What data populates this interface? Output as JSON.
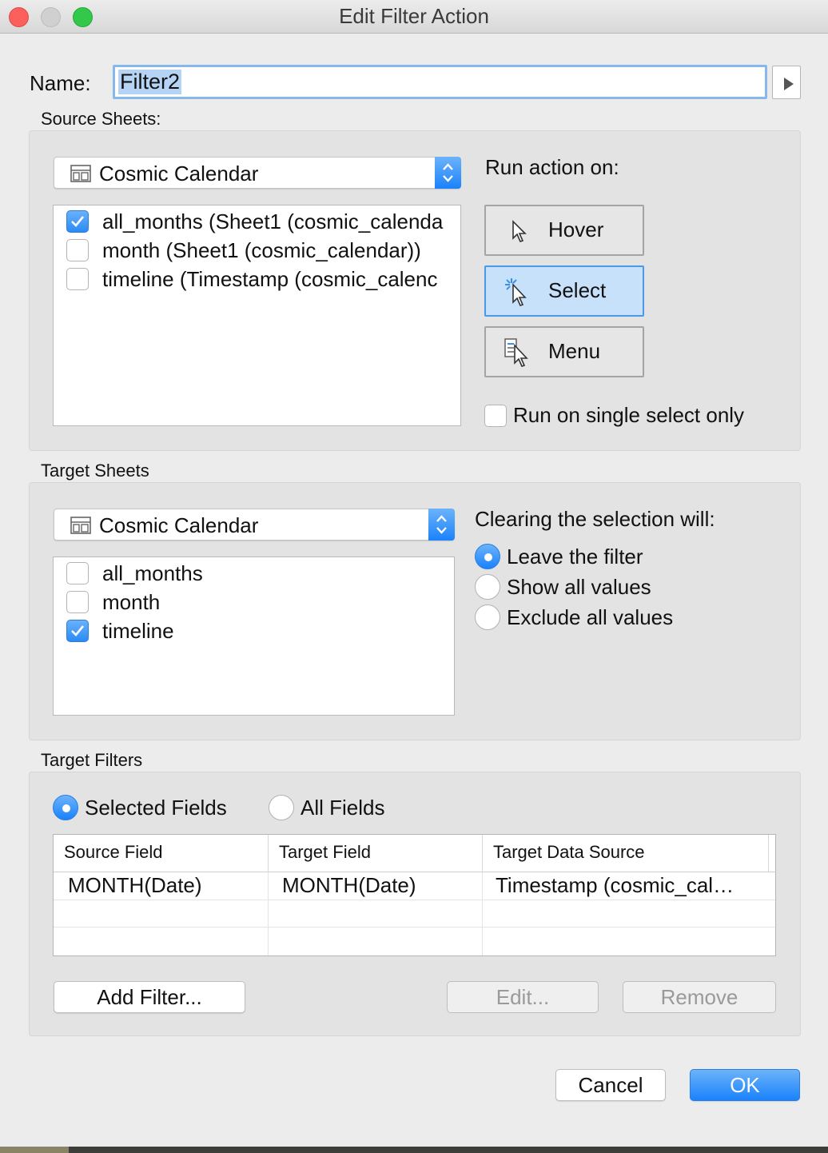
{
  "window": {
    "title": "Edit Filter Action"
  },
  "name": {
    "label": "Name:",
    "value": "Filter2"
  },
  "source": {
    "section_label": "Source Sheets:",
    "dropdown_value": "Cosmic Calendar",
    "sheets": [
      {
        "label": "all_months (Sheet1 (cosmic_calenda",
        "checked": true
      },
      {
        "label": "month (Sheet1 (cosmic_calendar))",
        "checked": false
      },
      {
        "label": "timeline (Timestamp (cosmic_calenc",
        "checked": false
      }
    ],
    "run_action_label": "Run action on:",
    "run_buttons": [
      {
        "label": "Hover",
        "icon": "pointer-icon",
        "active": false
      },
      {
        "label": "Select",
        "icon": "select-pointer-icon",
        "active": true
      },
      {
        "label": "Menu",
        "icon": "menu-pointer-icon",
        "active": false
      }
    ],
    "single_select_label": "Run on single select only",
    "single_select_checked": false
  },
  "target": {
    "section_label": "Target Sheets",
    "dropdown_value": "Cosmic Calendar",
    "sheets": [
      {
        "label": "all_months",
        "checked": false
      },
      {
        "label": "month",
        "checked": false
      },
      {
        "label": "timeline",
        "checked": true
      }
    ],
    "clearing_label": "Clearing the selection will:",
    "clearing_options": [
      {
        "label": "Leave the filter",
        "selected": true
      },
      {
        "label": "Show all values",
        "selected": false
      },
      {
        "label": "Exclude all values",
        "selected": false
      }
    ]
  },
  "filters": {
    "section_label": "Target Filters",
    "mode_options": [
      {
        "label": "Selected Fields",
        "selected": true
      },
      {
        "label": "All Fields",
        "selected": false
      }
    ],
    "columns": [
      "Source Field",
      "Target Field",
      "Target Data Source"
    ],
    "rows": [
      [
        "MONTH(Date)",
        "MONTH(Date)",
        "Timestamp (cosmic_cal…"
      ]
    ],
    "add_label": "Add Filter...",
    "edit_label": "Edit...",
    "remove_label": "Remove"
  },
  "footer": {
    "cancel_label": "Cancel",
    "ok_label": "OK"
  },
  "colors": {
    "accent": "#1a82fb",
    "selected_button": "#c7e1fb",
    "close": "#fc605c",
    "zoom": "#34c84a"
  }
}
